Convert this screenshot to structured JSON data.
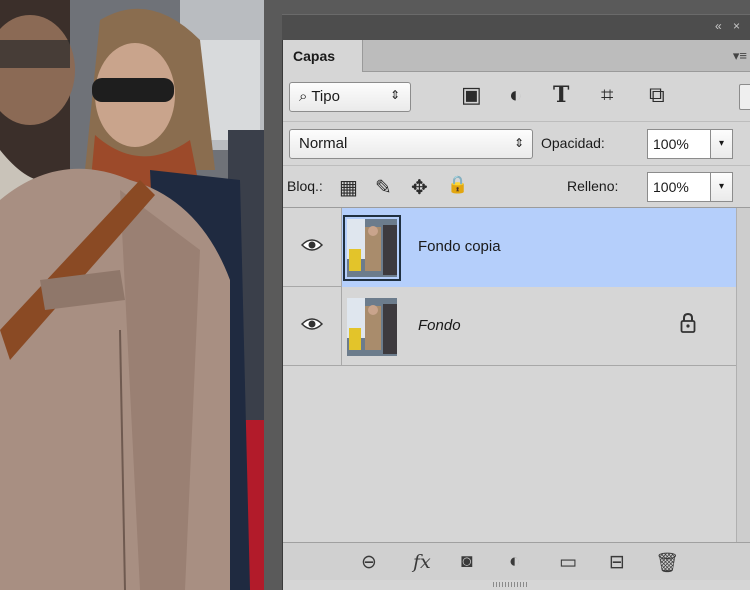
{
  "panel": {
    "collapse_icons": "«  ×",
    "tab_label": "Capas",
    "panel_menu_icon": "▾≡",
    "filter": {
      "select_value": "Tipo",
      "arrows": "⇕",
      "search_icon": "⌕",
      "tools": [
        {
          "name": "image-filter-icon",
          "glyph": "▣"
        },
        {
          "name": "adjustment-filter-icon",
          "glyph": "◐"
        },
        {
          "name": "type-filter-icon",
          "glyph": "T"
        },
        {
          "name": "shape-filter-icon",
          "glyph": "⌗"
        },
        {
          "name": "smart-object-filter-icon",
          "glyph": "⧉"
        }
      ]
    },
    "blend_mode": {
      "value": "Normal",
      "arrows": "⇕"
    },
    "opacity": {
      "label": "Opacidad:",
      "value": "100%",
      "drop": "▾"
    },
    "lock": {
      "label": "Bloq.:",
      "icons": [
        {
          "name": "lock-transparent-pixels-icon",
          "glyph": "▦"
        },
        {
          "name": "lock-image-pixels-icon",
          "glyph": "✎"
        },
        {
          "name": "lock-position-icon",
          "glyph": "✥"
        },
        {
          "name": "lock-all-icon",
          "glyph": "🔒"
        }
      ]
    },
    "fill": {
      "label": "Relleno:",
      "value": "100%",
      "drop": "▾"
    },
    "layers": [
      {
        "name": "Fondo copia",
        "selected": true,
        "italic": false,
        "locked": false
      },
      {
        "name": "Fondo",
        "selected": false,
        "italic": true,
        "locked": true
      }
    ],
    "bottom_icons": [
      {
        "name": "link-layers-icon",
        "glyph": "⊖"
      },
      {
        "name": "layer-style-fx-icon",
        "glyph": "fx"
      },
      {
        "name": "add-mask-icon",
        "glyph": "◙"
      },
      {
        "name": "new-adjustment-layer-icon",
        "glyph": "◐"
      },
      {
        "name": "new-group-folder-icon",
        "glyph": "▭"
      },
      {
        "name": "new-layer-icon",
        "glyph": "⊟"
      },
      {
        "name": "delete-layer-icon",
        "glyph": "🗑"
      }
    ]
  },
  "colors": {
    "selected_layer": "#b5cffb",
    "panel_bg": "#d6d6d6",
    "panel_frame": "#5a5a5a"
  }
}
